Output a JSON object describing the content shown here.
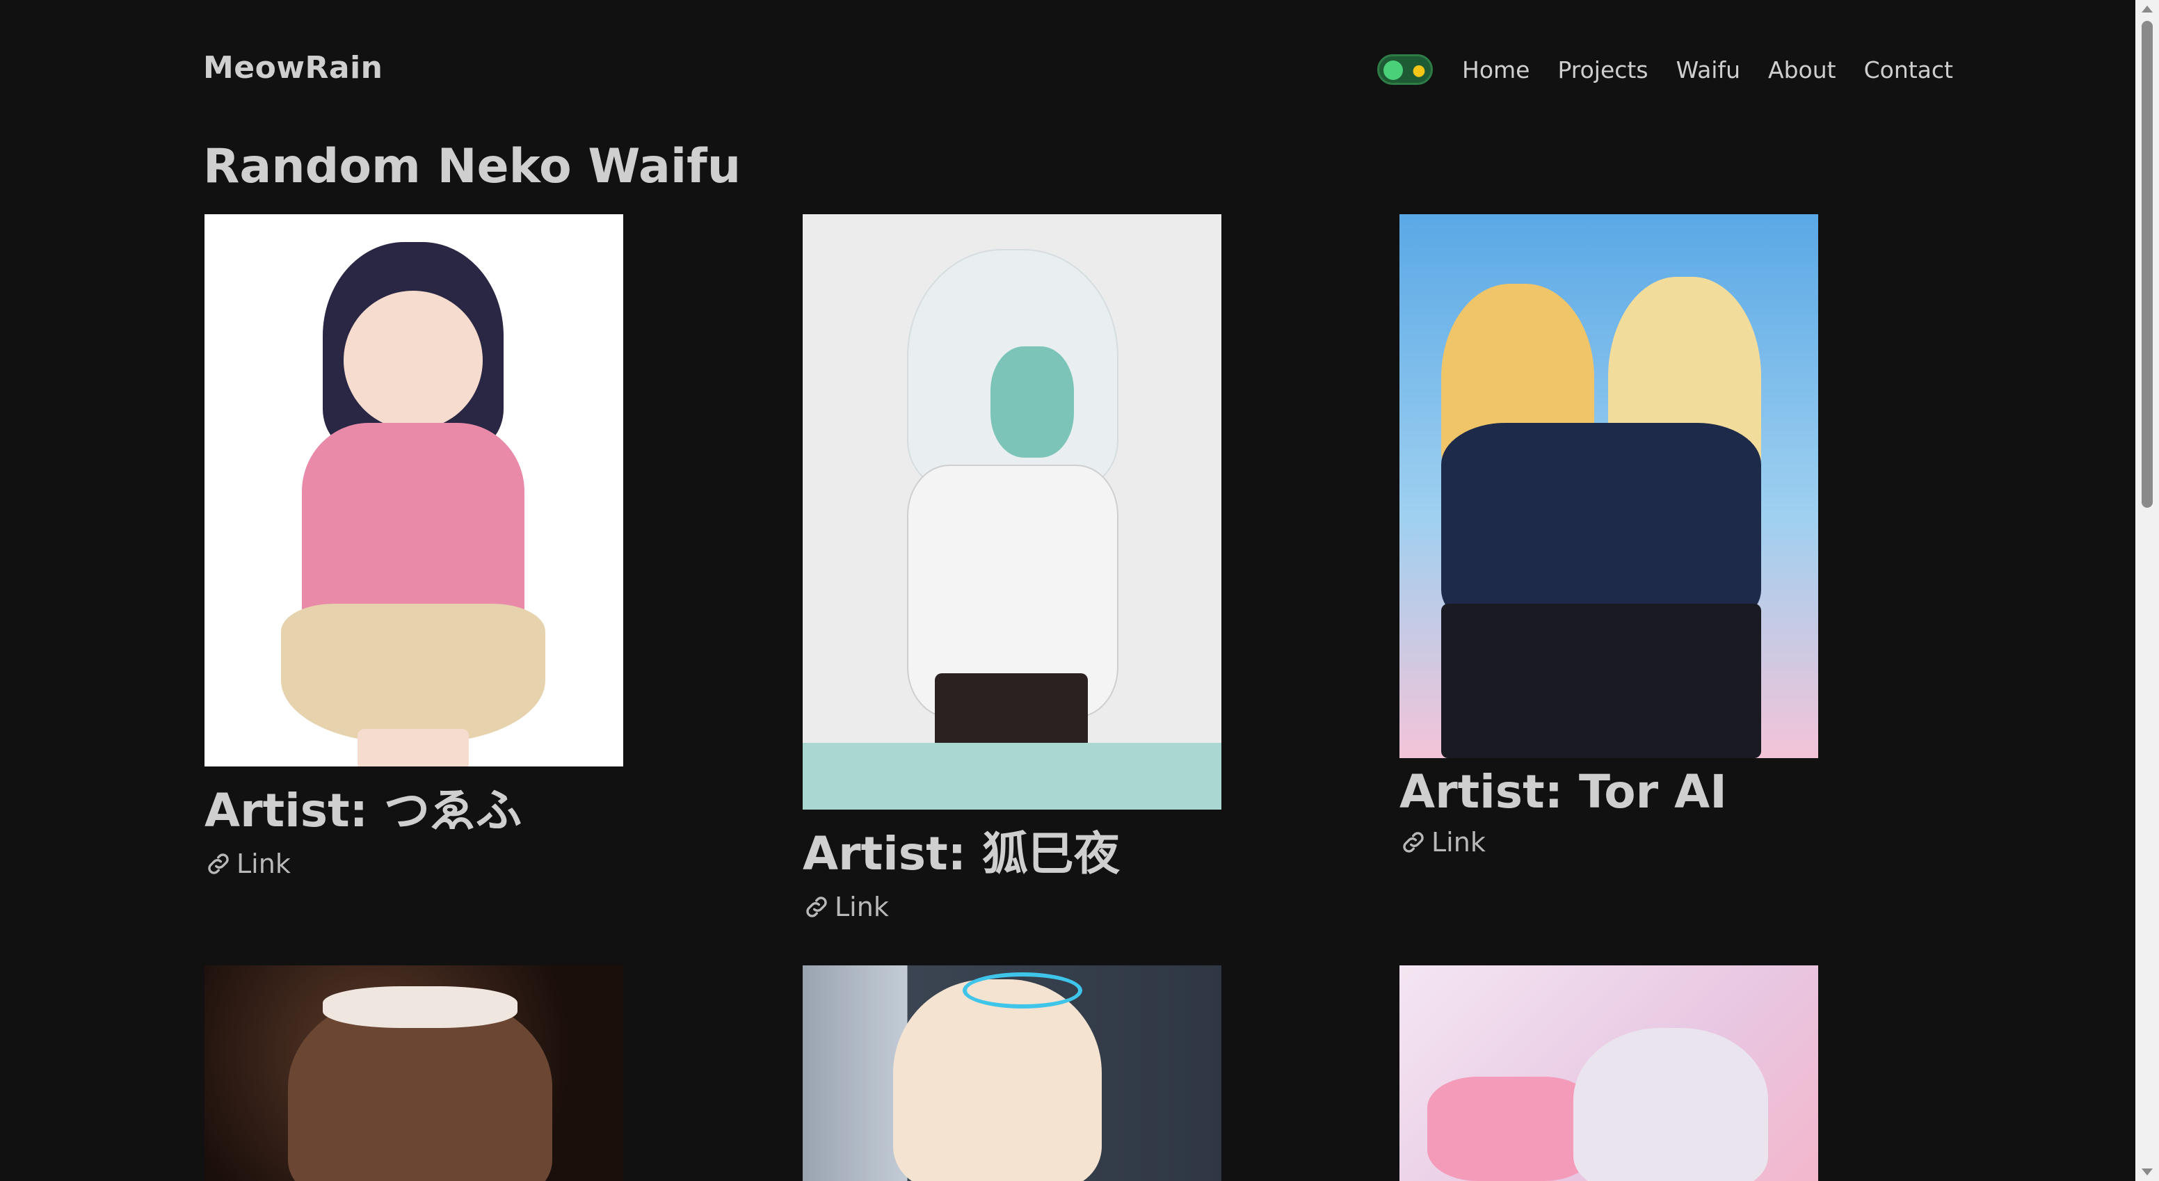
{
  "header": {
    "brand": "MeowRain",
    "nav": [
      "Home",
      "Projects",
      "Waifu",
      "About",
      "Contact"
    ],
    "theme_toggle": {
      "state": "dark",
      "icon": "sun-icon"
    }
  },
  "main": {
    "title": "Random Neko Waifu",
    "cards": [
      {
        "artist": "Artist: つゑふ",
        "link": "Link"
      },
      {
        "artist": "Artist: 狐巳夜",
        "link": "Link"
      },
      {
        "artist": "Artist: Tor AI",
        "link": "Link"
      }
    ]
  },
  "colors": {
    "background": "#111111",
    "text": "#cfcfcf",
    "toggle_accent": "#4bd07a"
  }
}
